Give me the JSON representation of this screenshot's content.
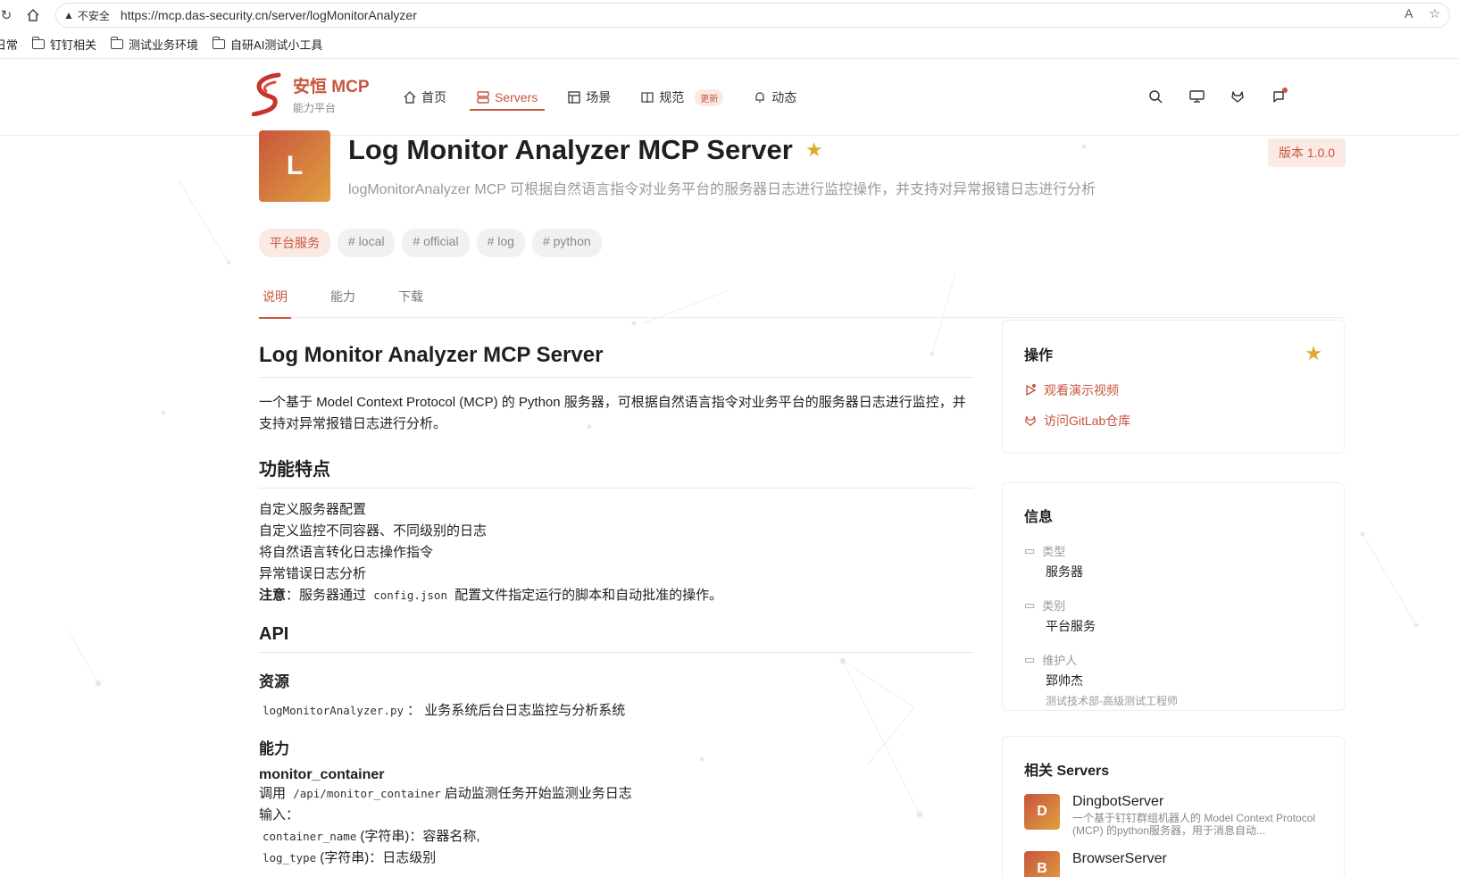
{
  "browser": {
    "security": "不安全",
    "url": "https://mcp.das-security.cn/server/logMonitorAnalyzer",
    "bookmarks": [
      "日常",
      "钉钉相关",
      "测试业务环境",
      "自研AI测试小工具"
    ]
  },
  "header": {
    "brand": "安恒 MCP",
    "brand_sub": "能力平台",
    "nav": [
      {
        "label": "首页",
        "icon": "home-icon"
      },
      {
        "label": "Servers",
        "icon": "server-icon"
      },
      {
        "label": "场景",
        "icon": "layout-icon"
      },
      {
        "label": "规范",
        "icon": "book-icon",
        "badge": "更新"
      },
      {
        "label": "动态",
        "icon": "bell-icon"
      }
    ],
    "accent": "#c8553d"
  },
  "hero": {
    "avatar_letter": "L",
    "title": "Log Monitor Analyzer MCP Server",
    "description": "logMonitorAnalyzer MCP 可根据自然语言指令对业务平台的服务器日志进行监控操作，并支持对异常报错日志进行分析",
    "version": "版本 1.0.0",
    "tags": [
      "平台服务",
      "# local",
      "# official",
      "# log",
      "# python"
    ]
  },
  "tabs": [
    "说明",
    "能力",
    "下载"
  ],
  "article": {
    "h1": "Log Monitor Analyzer MCP Server",
    "intro": "一个基于 Model Context Protocol (MCP) 的 Python 服务器，可根据自然语言指令对业务平台的服务器日志进行监控，并支持对异常报错日志进行分析。",
    "features_title": "功能特点",
    "features": [
      "自定义服务器配置",
      "自定义监控不同容器、不同级别的日志",
      "将自然语言转化日志操作指令",
      "异常错误日志分析"
    ],
    "note_label": "注意",
    "note_pre": "：服务器通过",
    "note_code": "config.json",
    "note_post": "配置文件指定运行的脚本和自动批准的操作。",
    "api_title": "API",
    "resource_title": "资源",
    "resource_code": "logMonitorAnalyzer.py",
    "resource_text": "： 业务系统后台日志监控与分析系统",
    "ability_title": "能力",
    "tool_name": "monitor_container",
    "tool_call_pre": "调用",
    "tool_call_code": "/api/monitor_container",
    "tool_call_post": "启动监测任务开始监测业务日志",
    "input_label": "输入：",
    "param1_code": "container_name",
    "param1_text": "(字符串)：容器名称,",
    "param2_code": "log_type",
    "param2_text": "(字符串)：日志级别"
  },
  "sidebar": {
    "ops_title": "操作",
    "ops_links": [
      "观看演示视频",
      "访问GitLab仓库"
    ],
    "info_title": "信息",
    "info": [
      {
        "label": "类型",
        "value": "服务器"
      },
      {
        "label": "类别",
        "value": "平台服务"
      },
      {
        "label": "维护人",
        "value": "郅帅杰",
        "sub": "测试技术部-高级测试工程师"
      }
    ],
    "related_title": "相关 Servers",
    "related": [
      {
        "letter": "D",
        "name": "DingbotServer",
        "desc": "一个基于钉钉群组机器人的 Model Context Protocol (MCP) 的python服务器，用于消息自动..."
      },
      {
        "letter": "B",
        "name": "BrowserServer",
        "desc": ""
      }
    ]
  }
}
